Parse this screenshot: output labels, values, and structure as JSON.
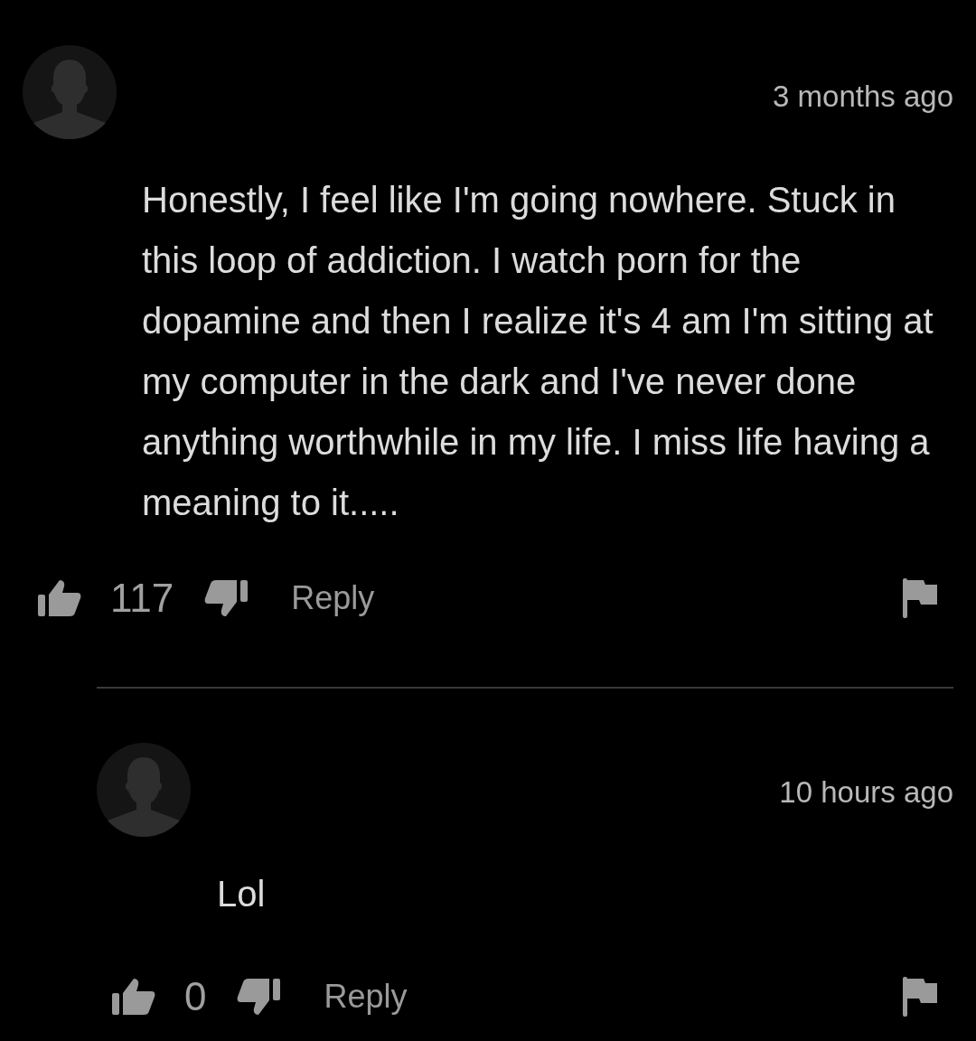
{
  "comments": [
    {
      "time": "3 months ago",
      "text": "Honestly, I feel like I'm going nowhere. Stuck in this loop of addiction. I watch porn for the dopamine and then I realize it's 4 am I'm sitting at my computer in the dark and I've never done anything worthwhile in my life. I miss life having a meaning to it.....",
      "likes": "117",
      "reply_label": "Reply",
      "children": [
        {
          "time": "10 hours ago",
          "text": "Lol",
          "likes": "0",
          "reply_label": "Reply"
        }
      ]
    }
  ]
}
